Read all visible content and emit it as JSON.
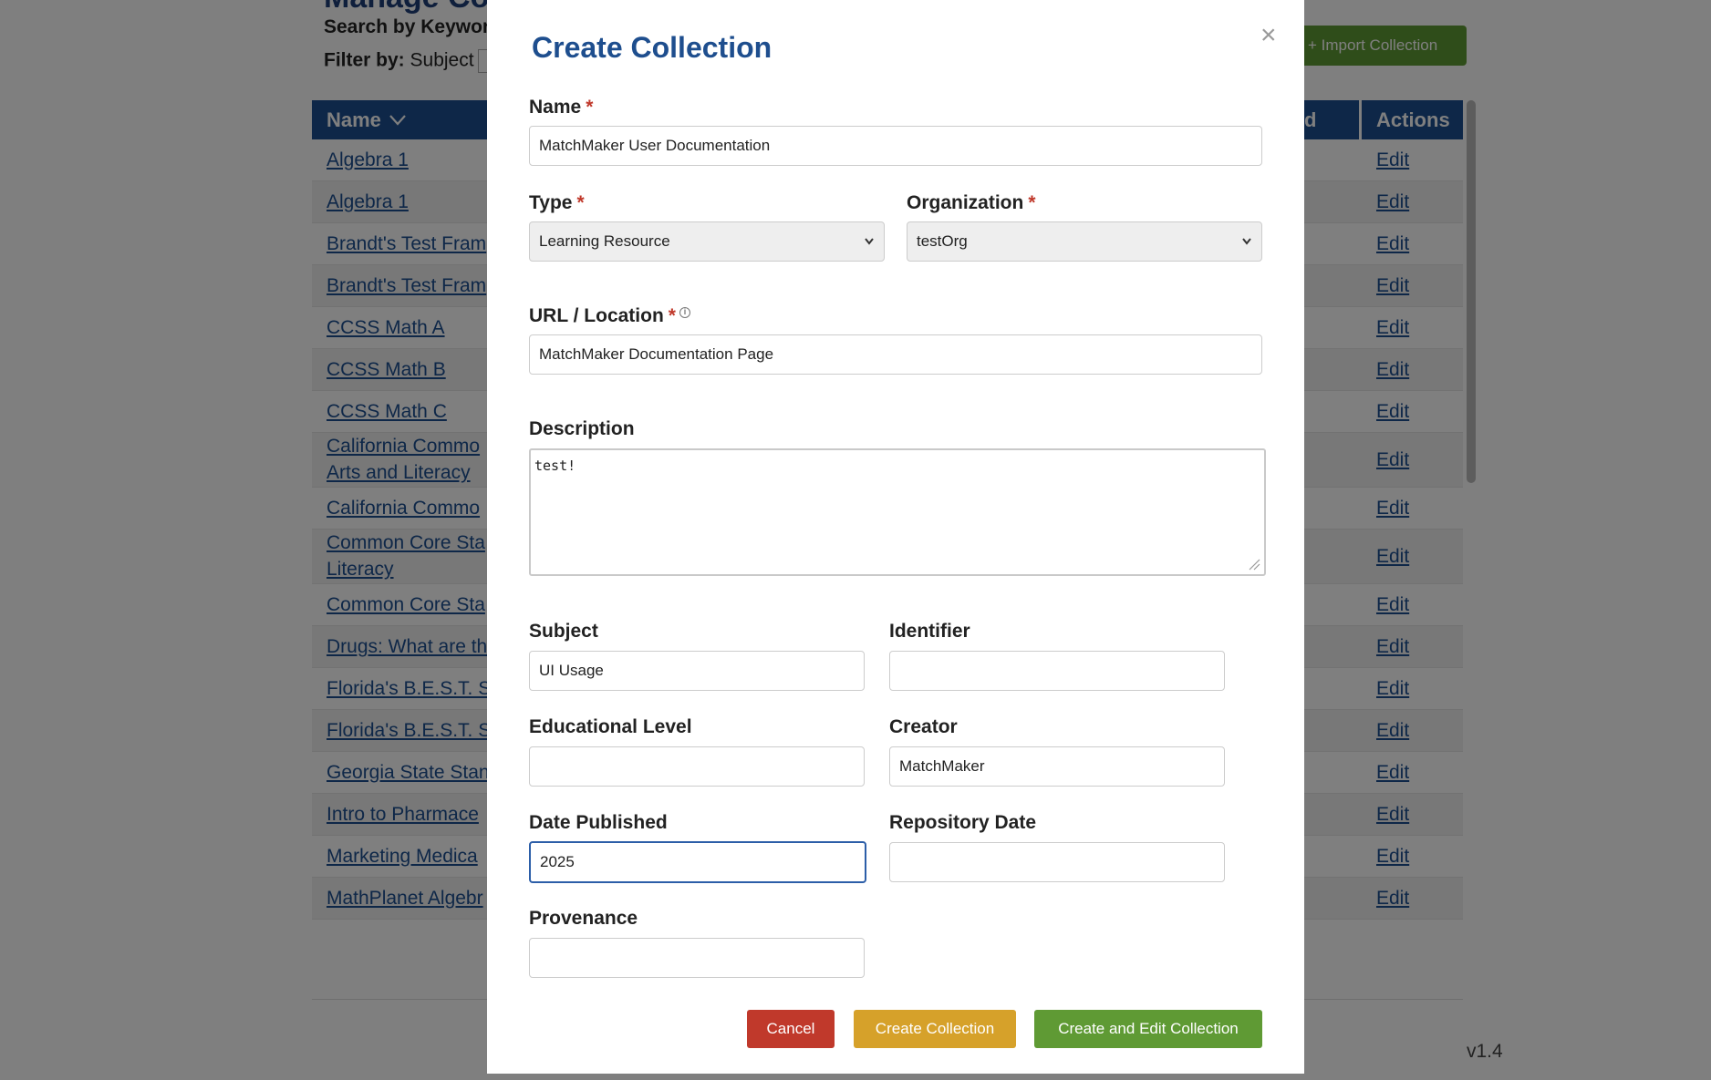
{
  "background": {
    "heading": "Manage Collections",
    "search_label": "Search by Keyword",
    "filter_label": "Filter by:",
    "filter_value": "Subject",
    "import_button": "+ Import Collection",
    "table": {
      "col_name": "Name",
      "col_partial": "d",
      "col_actions": "Actions",
      "rows": [
        {
          "name": "Algebra 1",
          "action": "Edit"
        },
        {
          "name": "Algebra 1",
          "action": "Edit"
        },
        {
          "name": "Brandt's Test Fram",
          "action": "Edit"
        },
        {
          "name": "Brandt's Test Fram",
          "action": "Edit"
        },
        {
          "name": "CCSS Math A",
          "action": "Edit"
        },
        {
          "name": "CCSS Math B",
          "action": "Edit"
        },
        {
          "name": "CCSS Math C",
          "action": "Edit"
        },
        {
          "name": "California Commo",
          "name2": "Arts and Literacy",
          "action": "Edit"
        },
        {
          "name": "California Commo",
          "action": "Edit"
        },
        {
          "name": "Common Core Sta",
          "name2": "Literacy",
          "action": "Edit"
        },
        {
          "name": "Common Core Sta",
          "action": "Edit"
        },
        {
          "name": "Drugs: What are th",
          "action": "Edit"
        },
        {
          "name": "Florida's B.E.S.T. St",
          "action": "Edit"
        },
        {
          "name": "Florida's B.E.S.T. St",
          "action": "Edit"
        },
        {
          "name": "Georgia State Stan",
          "action": "Edit"
        },
        {
          "name": "Intro to Pharmace",
          "action": "Edit"
        },
        {
          "name": "Marketing Medica",
          "action": "Edit"
        },
        {
          "name": "MathPlanet Algebr",
          "action": "Edit"
        }
      ]
    },
    "version": "v1.4"
  },
  "modal": {
    "title": "Create Collection",
    "close_glyph": "×",
    "required_mark": "*",
    "fields": {
      "name": {
        "label": "Name",
        "value": "MatchMaker User Documentation"
      },
      "type": {
        "label": "Type",
        "value": "Learning Resource"
      },
      "organization": {
        "label": "Organization",
        "value": "testOrg"
      },
      "url": {
        "label": "URL / Location",
        "value": "MatchMaker Documentation Page"
      },
      "description": {
        "label": "Description",
        "value": "test!"
      },
      "subject": {
        "label": "Subject",
        "value": "UI Usage"
      },
      "identifier": {
        "label": "Identifier",
        "value": ""
      },
      "educational_level": {
        "label": "Educational Level",
        "value": ""
      },
      "creator": {
        "label": "Creator",
        "value": "MatchMaker"
      },
      "date_published": {
        "label": "Date Published",
        "value": "2025"
      },
      "repository_date": {
        "label": "Repository Date",
        "value": ""
      },
      "provenance": {
        "label": "Provenance",
        "value": ""
      }
    },
    "buttons": {
      "cancel": "Cancel",
      "create": "Create Collection",
      "create_edit": "Create and Edit Collection"
    }
  },
  "icons": {
    "close": "close-icon",
    "info": "info-icon",
    "select_caret": "chevron-down-icon",
    "sort": "chevron-down-icon"
  },
  "colors": {
    "primary": "#1e4e8e",
    "cancel": "#c0392b",
    "create": "#d6a12a",
    "create_edit": "#5f9a34"
  }
}
